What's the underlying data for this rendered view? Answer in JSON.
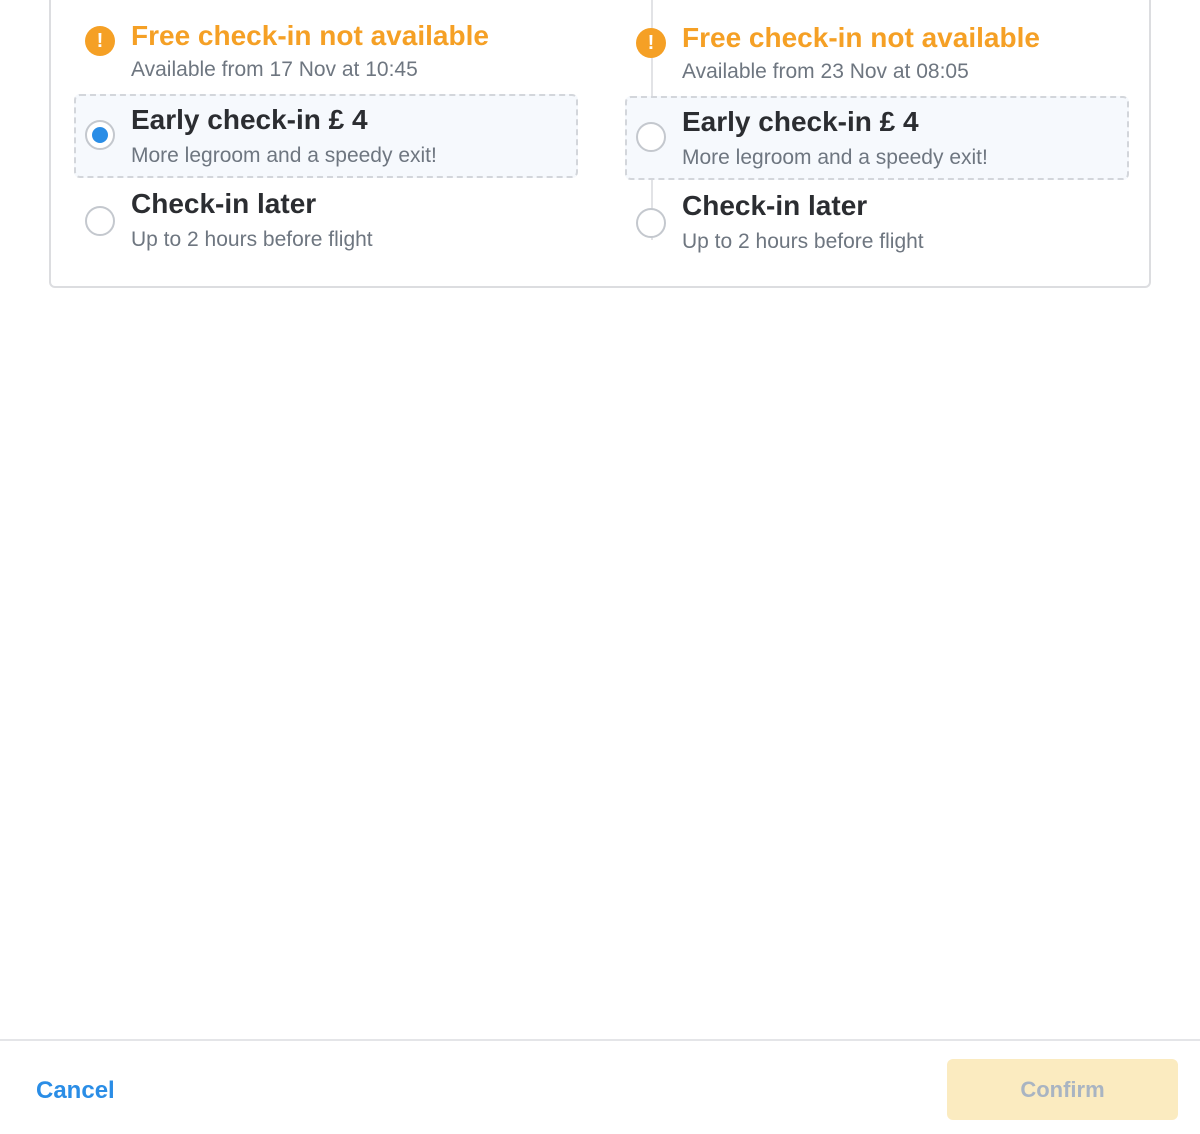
{
  "flights": [
    {
      "warning": {
        "icon": "exclamation-icon",
        "icon_glyph": "!",
        "title": "Free check-in not available",
        "subtitle": "Available from 17 Nov at 10:45"
      },
      "options": {
        "early": {
          "title": "Early check-in £ 4",
          "subtitle": "More legroom and a speedy exit!",
          "selected": true
        },
        "later": {
          "title": "Check-in later",
          "subtitle": "Up to 2 hours before flight",
          "selected": false
        }
      }
    },
    {
      "warning": {
        "icon": "exclamation-icon",
        "icon_glyph": "!",
        "title": "Free check-in not available",
        "subtitle": "Available from 23 Nov at 08:05"
      },
      "options": {
        "early": {
          "title": "Early check-in £ 4",
          "subtitle": "More legroom and a speedy exit!",
          "selected": false
        },
        "later": {
          "title": "Check-in later",
          "subtitle": "Up to 2 hours before flight",
          "selected": false
        }
      }
    }
  ],
  "footer": {
    "cancel_label": "Cancel",
    "confirm_label": "Confirm",
    "confirm_enabled": false
  },
  "colors": {
    "warning": "#f5a025",
    "accent": "#2a8de6",
    "confirm_bg_disabled": "#fbebc0",
    "confirm_text_disabled": "#a9b4c2"
  }
}
